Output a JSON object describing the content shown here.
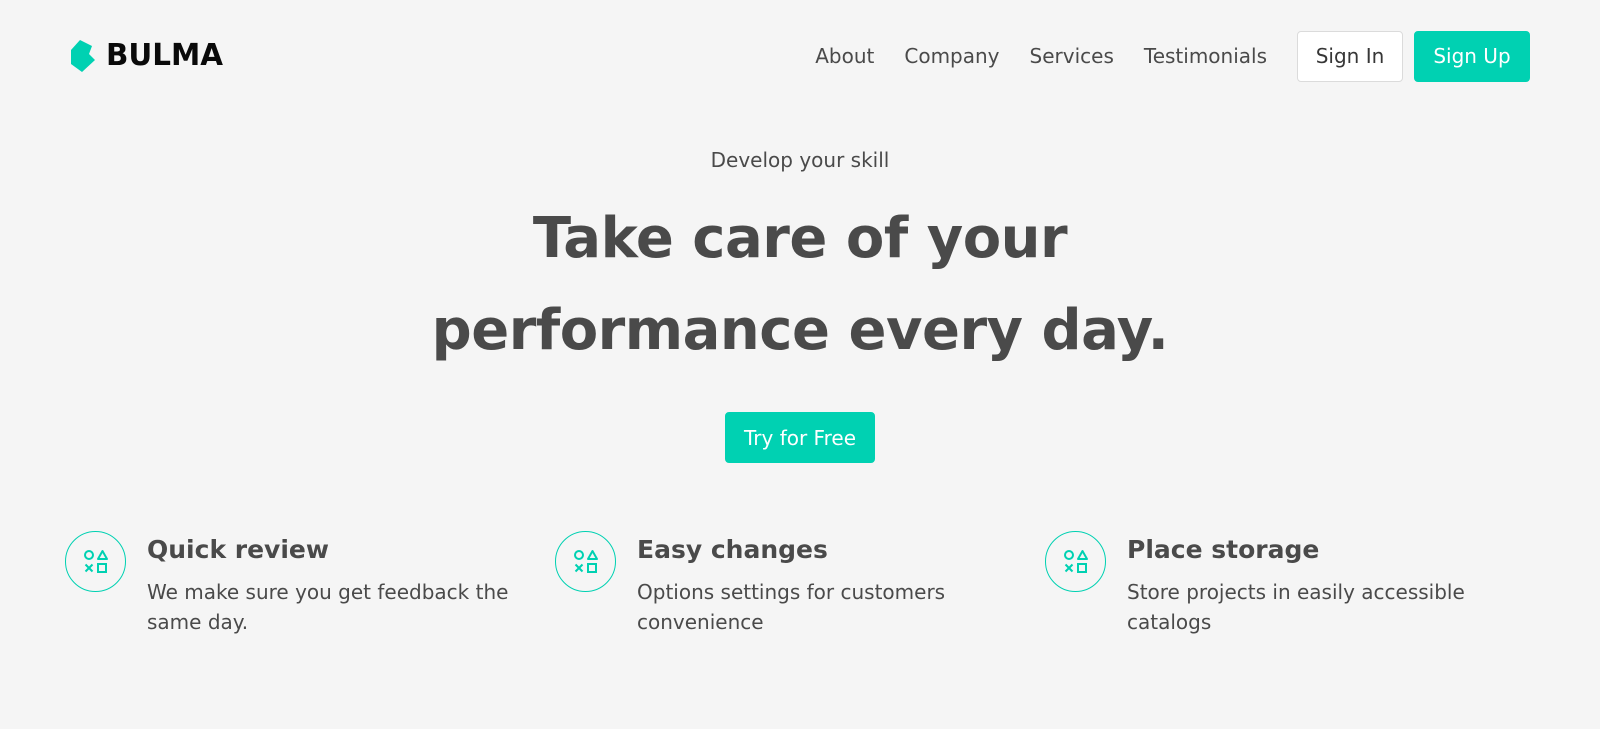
{
  "brand": {
    "name": "BULMA",
    "icon": "bulma-logo-icon",
    "color": "#00d1b2"
  },
  "nav": {
    "links": [
      "About",
      "Company",
      "Services",
      "Testimonials"
    ],
    "sign_in": "Sign In",
    "sign_up": "Sign Up"
  },
  "hero": {
    "subtitle": "Develop your skill",
    "title_line1": "Take care of your",
    "title_line2": "performance every day.",
    "cta": "Try for Free"
  },
  "features": [
    {
      "icon": "shapes-icon",
      "title": "Quick review",
      "description": "We make sure you get feedback the same day."
    },
    {
      "icon": "shapes-icon",
      "title": "Easy changes",
      "description": "Options settings for customers convenience"
    },
    {
      "icon": "shapes-icon",
      "title": "Place storage",
      "description": "Store projects in easily accessible catalogs"
    }
  ],
  "colors": {
    "primary": "#00d1b2",
    "background": "#f5f5f5",
    "text": "#4a4a4a"
  }
}
